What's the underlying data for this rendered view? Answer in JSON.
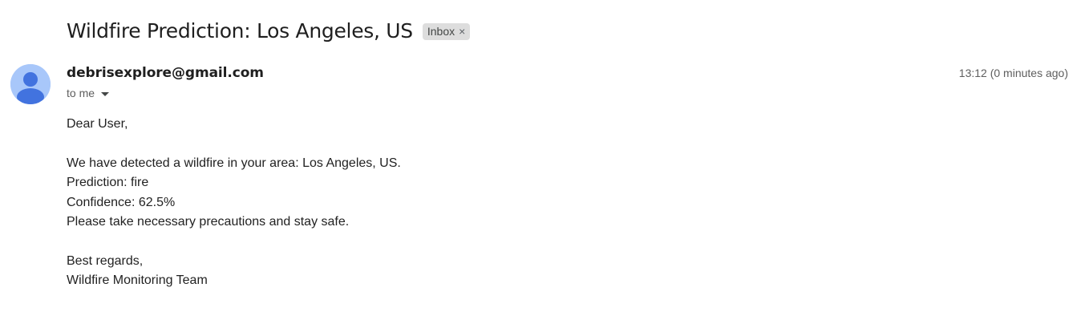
{
  "email": {
    "subject": "Wildfire Prediction: Los Angeles, US",
    "label": {
      "text": "Inbox",
      "close_glyph": "×"
    },
    "sender": "debrisexplore@gmail.com",
    "recipient": "to me",
    "timestamp": "13:12 (0 minutes ago)",
    "avatar_icon": "default-person-avatar",
    "body": {
      "greeting": "Dear User,",
      "line1": "We have detected a wildfire in your area: Los Angeles, US.",
      "line2": "Prediction: fire",
      "line3": "Confidence: 62.5%",
      "line4": "Please take necessary precautions and stay safe.",
      "closing": "Best regards,",
      "signature": "Wildfire Monitoring Team"
    }
  },
  "colors": {
    "avatar_bg": "#a8c7fa",
    "avatar_fg": "#4273df"
  }
}
